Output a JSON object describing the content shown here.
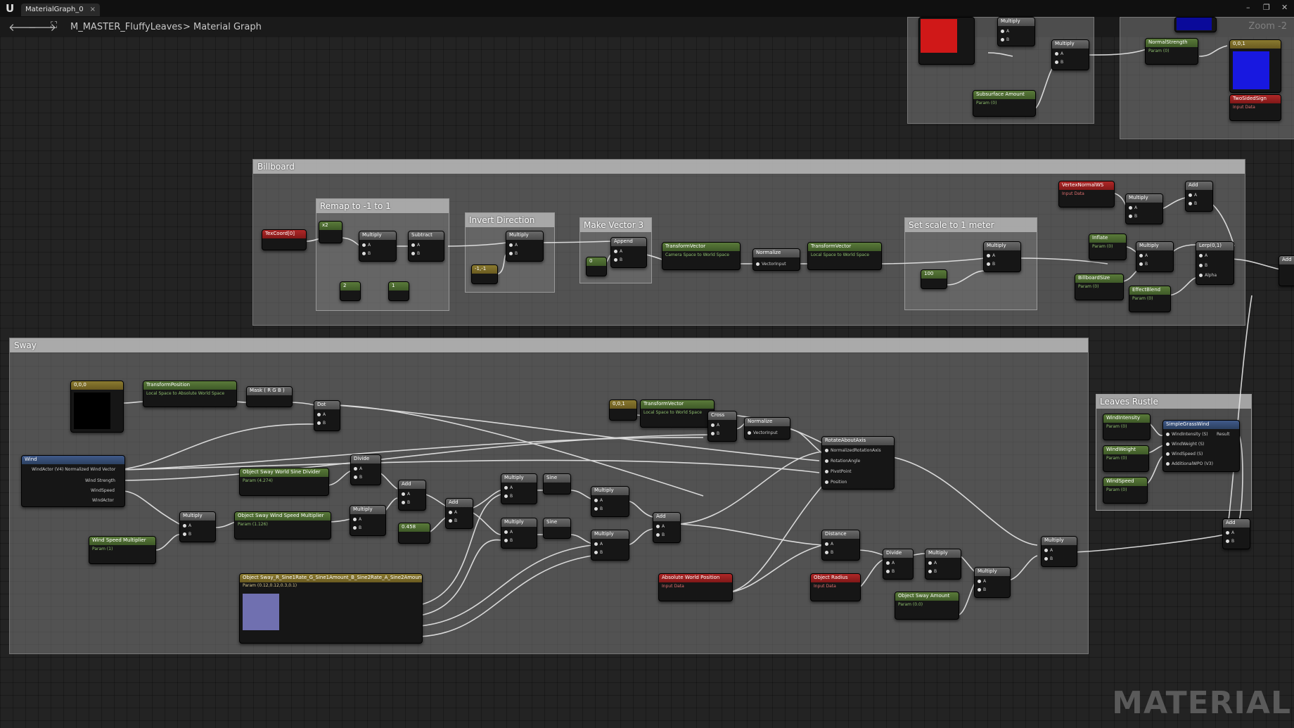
{
  "window": {
    "tab_label": "MaterialGraph_0",
    "tab_close": "×",
    "minimize": "–",
    "restore": "❐",
    "close": "✕"
  },
  "breadcrumb": {
    "back": "🡐",
    "forward": "🡒",
    "asset": "M_MASTER_FluffyLeaves",
    "separator": ">",
    "graph": "Material Graph"
  },
  "zoom_text": "Zoom -2",
  "watermark": "MATERIAL",
  "comments": {
    "billboard": "Billboard",
    "sway": "Sway",
    "remap": "Remap to -1 to 1",
    "invert": "Invert Direction",
    "makevec": "Make Vector 3",
    "scale": "Set scale to 1 meter",
    "leaves": "Leaves Rustle"
  },
  "nodes": {
    "texcoord": "TexCoord[0]",
    "x2": "x2",
    "multiply": "Multiply",
    "subtract": "Subtract",
    "one": "1",
    "two": "2",
    "neg1": "-1,-1",
    "append": "Append",
    "zero": "0",
    "transformvector": "TransformVector",
    "camera_to_world": "Camera Space to World Space",
    "normalize": "Normalize",
    "vectorinput": "VectorInput",
    "local_to_world": "Local Space to World Space",
    "hundred": "100",
    "vertexnormal": "VertexNormalWS",
    "inputdata": "Input Data",
    "add": "Add",
    "inflate": "Inflate",
    "param": "Param (0)",
    "billboardsize": "BillboardSize",
    "effectblend": "EffectBlend",
    "lerp": "Lerp(0,1)",
    "alpha": "Alpha",
    "a": "A",
    "b": "B",
    "vec000": "0,0,0",
    "transformposition": "TransformPosition",
    "local_to_abs": "Local Space to Absolute World Space",
    "mask": "Mask ( R G B )",
    "dot": "Dot",
    "wind": "Wind",
    "windactor_vec": "WindActor (V4) Normalized Wind Vector",
    "wind_strength": "Wind Strength",
    "windspeed": "WindSpeed",
    "windactor": "WindActor",
    "divide": "Divide",
    "sine_divider": "Object Sway World Sine Divider",
    "sine_divider_param": "Param (4.274)",
    "wind_speed_mult": "Object Sway Wind Speed Multiplier",
    "wind_speed_mult_param": "Param (1.126)",
    "speed_multiplier": "Wind Speed Multiplier",
    "param1": "Param (1)",
    "const458": "0.458",
    "sine": "Sine",
    "vec001": "0,0,1",
    "cross": "Cross",
    "rotateaboutaxis": "RotateAboutAxis",
    "rot_axis": "NormalizedRotationAxis",
    "rot_angle": "RotationAngle",
    "pivot": "PivotPoint",
    "position": "Position",
    "distance": "Distance",
    "absworldpos": "Absolute World Position",
    "objradius": "Object Radius",
    "sway_amount": "Object Sway Amount",
    "sway_amount_param": "Param (0.0)",
    "sway_texture": "Object Sway_R_Sine1Rate_G_Sine1Amount_B_Sine2Rate_A_Sine2Amount",
    "sway_texture_param": "Param (0.12,0.12,0.3,0.1)",
    "windintensity": "WindIntensity",
    "windweight": "WindWeight",
    "simplegrasswind": "SimpleGrassWind",
    "result": "Result",
    "windintensity_s": "WindIntensity (S)",
    "windweight_s": "WindWeight (S)",
    "windspeed_s": "WindSpeed (S)",
    "additionalwpo": "AdditionalWPO (V3)",
    "subsurface": "Subsurface Amount",
    "normalstrength": "NormalStrength",
    "twosidedsign": "TwoSidedSign",
    "vec001b": "0,0,1"
  },
  "colors": {
    "red_swatch": "#d01818",
    "blue_swatch": "#1818e0",
    "black_swatch": "#000000",
    "purple_swatch": "#7070b0"
  }
}
